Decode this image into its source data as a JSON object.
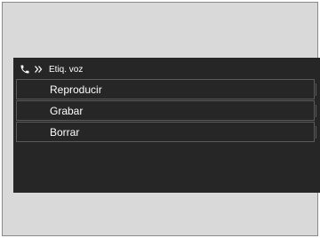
{
  "header": {
    "phone_icon": "phone-handset-icon",
    "voice_icon": "voice-chevrons-icon",
    "title": "Etiq. voz"
  },
  "menu": {
    "items": [
      {
        "label": "Reproducir"
      },
      {
        "label": "Grabar"
      },
      {
        "label": "Borrar"
      }
    ]
  },
  "colors": {
    "frame_bg": "#d9d9d9",
    "screen_bg": "#262626",
    "text": "#ffffff",
    "item_border": "#5a5a5a"
  }
}
